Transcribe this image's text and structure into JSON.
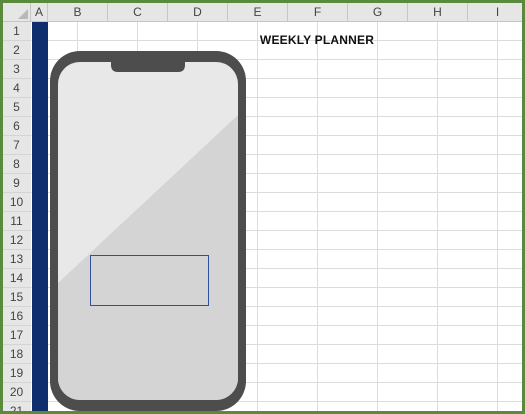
{
  "sheet": {
    "title": "WEEKLY PLANNER",
    "columns": [
      "A",
      "B",
      "C",
      "D",
      "E",
      "F",
      "G",
      "H",
      "I"
    ],
    "rows": [
      "1",
      "2",
      "3",
      "4",
      "5",
      "6",
      "7",
      "8",
      "9",
      "10",
      "11",
      "12",
      "13",
      "14",
      "15",
      "16",
      "17",
      "18",
      "19",
      "20",
      "21"
    ]
  },
  "colors": {
    "frame_border": "#5a8a3c",
    "column_a_fill": "#0f2e6e",
    "phone_body": "#4d4d4d",
    "phone_screen_light": "#e8e8e8",
    "phone_screen_dark": "#d4d4d4",
    "selection_box": "#2f4f9f"
  },
  "icons": {
    "phone": "smartphone-illustration"
  }
}
